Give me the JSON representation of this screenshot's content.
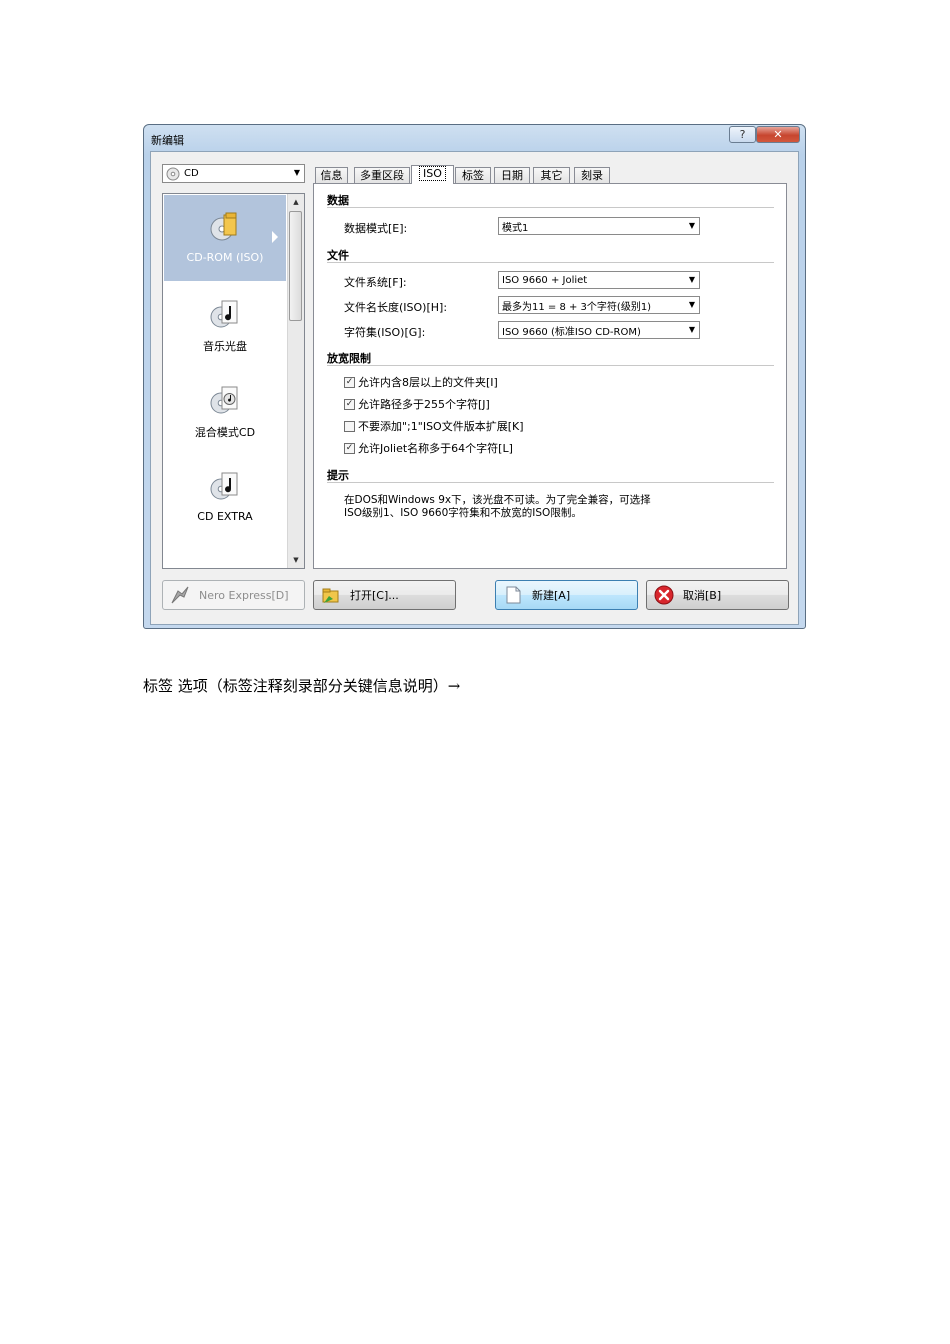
{
  "window": {
    "title": "新编辑",
    "help_label": "?",
    "close_label": "✕"
  },
  "media_combo": {
    "value": "CD"
  },
  "compilation_types": [
    {
      "label": "CD-ROM (ISO)",
      "selected": true,
      "icon": "data-disc-icon"
    },
    {
      "label": "音乐光盘",
      "selected": false,
      "icon": "music-disc-icon"
    },
    {
      "label": "混合模式CD",
      "selected": false,
      "icon": "mixed-disc-icon"
    },
    {
      "label": "CD EXTRA",
      "selected": false,
      "icon": "extra-disc-icon"
    }
  ],
  "tabs": [
    {
      "label": "信息",
      "active": false
    },
    {
      "label": "多重区段",
      "active": false
    },
    {
      "label": "ISO",
      "active": true
    },
    {
      "label": "标签",
      "active": false
    },
    {
      "label": "日期",
      "active": false
    },
    {
      "label": "其它",
      "active": false
    },
    {
      "label": "刻录",
      "active": false
    }
  ],
  "iso_panel": {
    "data_section": "数据",
    "data_mode_label": "数据模式[E]:",
    "data_mode_value": "模式1",
    "file_section": "文件",
    "file_system_label": "文件系统[F]:",
    "file_system_value": "ISO 9660 + Joliet",
    "filename_length_label": "文件名长度(ISO)[H]:",
    "filename_length_value": "最多为11 = 8 + 3个字符(级别1)",
    "charset_label": "字符集(ISO)[G]:",
    "charset_value": "ISO 9660 (标准ISO CD-ROM)",
    "relax_section": "放宽限制",
    "options": [
      {
        "label": "允许内含8层以上的文件夹[I]",
        "checked": true
      },
      {
        "label": "允许路径多于255个字符[J]",
        "checked": true
      },
      {
        "label": "不要添加\";1\"ISO文件版本扩展[K]",
        "checked": false
      },
      {
        "label": "允许Joliet名称多于64个字符[L]",
        "checked": true
      }
    ],
    "hint_section": "提示",
    "hint_line1": "在DOS和Windows 9x下，该光盘不可读。为了完全兼容，可选择",
    "hint_line2": "ISO级别1、ISO 9660字符集和不放宽的ISO限制。"
  },
  "buttons": {
    "nero_express": "Nero Express[D]",
    "open": "打开[C]...",
    "new": "新建[A]",
    "cancel": "取消[B]"
  },
  "caption": "标签 选项（标签注释刻录部分关键信息说明）→"
}
